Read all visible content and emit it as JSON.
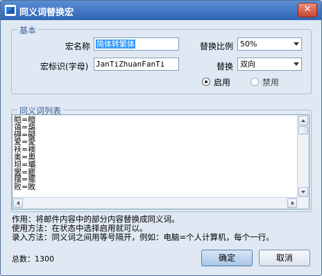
{
  "window": {
    "title": "同义词替换宏",
    "close_glyph": "✕"
  },
  "basic": {
    "group_label": "基本",
    "macro_name_label": "宏名称",
    "macro_name_value": "简体转繁体",
    "macro_id_label": "宏标识(字母)",
    "macro_id_value": "JanTiZhuanFanTi",
    "ratio_label": "替换比例",
    "ratio_value": "50%",
    "replace_label": "替换",
    "replace_value": "双向",
    "enable_label": "启用",
    "disable_label": "禁用"
  },
  "wordlist": {
    "group_label": "同义词列表",
    "items": [
      "皑=皚",
      "蔼=藹",
      "碍=礙",
      "爱=愛",
      "袄=襖",
      "奥=奧",
      "坝=壩",
      "罢=罷",
      "摆=擺",
      "败=敗"
    ]
  },
  "info": {
    "line1": "作用：将邮件内容中的部分内容替换成同义词。",
    "line2": "使用方法：在状态中选择启用就可以。",
    "line3": "录入方法：同义词之间用等号隔开，例如：电脑=个人计算机，每个一行。"
  },
  "footer": {
    "total_label": "总数：1300",
    "ok_label": "确定",
    "cancel_label": "取消"
  }
}
